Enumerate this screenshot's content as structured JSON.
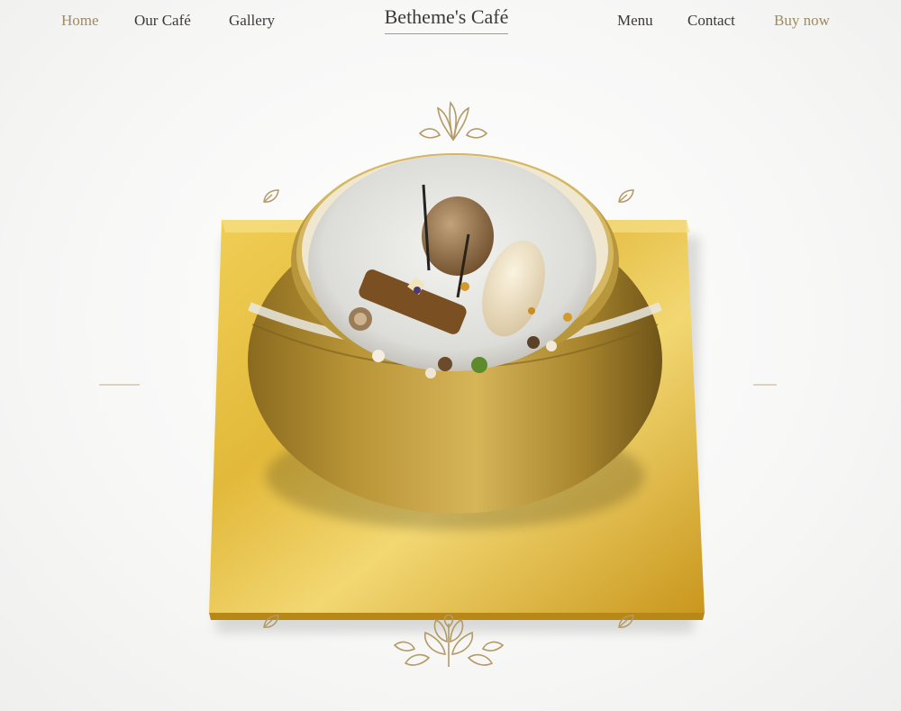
{
  "nav": {
    "left": [
      {
        "label": "Home",
        "accent": true
      },
      {
        "label": "Our Café",
        "accent": false
      },
      {
        "label": "Gallery",
        "accent": false
      }
    ],
    "brand": "Betheme's Café",
    "right": [
      {
        "label": "Menu",
        "accent": false
      },
      {
        "label": "Contact",
        "accent": false
      },
      {
        "label": "Buy now",
        "accent": true
      }
    ]
  },
  "colors": {
    "text": "#3c3a36",
    "accent": "#a08a63",
    "gold": "#d9b23a",
    "ornament": "#b49a66"
  },
  "hero": {
    "image": "gold-bowl-dessert-on-gold-square-plate",
    "ornaments": [
      "leaf-sprig-icon",
      "leaf-icon",
      "leaf-bouquet-icon"
    ]
  }
}
